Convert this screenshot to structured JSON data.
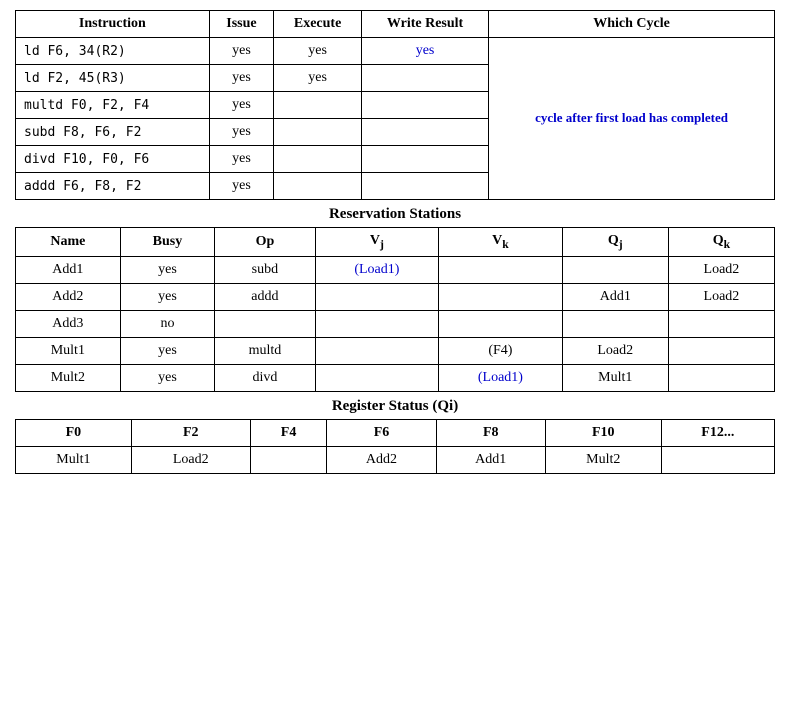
{
  "instruction_table": {
    "headers": [
      "Instruction",
      "Issue",
      "Execute",
      "Write Result",
      "Which Cycle"
    ],
    "rows": [
      {
        "instr": "ld F6, 34(R2)",
        "issue": "yes",
        "execute": "yes",
        "write": "yes",
        "write_blue": true,
        "which_cycle": ""
      },
      {
        "instr": "ld F2, 45(R3)",
        "issue": "yes",
        "execute": "yes",
        "write": "",
        "which_cycle": ""
      },
      {
        "instr": "multd F0, F2, F4",
        "issue": "yes",
        "execute": "",
        "write": "",
        "which_cycle": ""
      },
      {
        "instr": "subd F8, F6, F2",
        "issue": "yes",
        "execute": "",
        "write": "",
        "which_cycle": ""
      },
      {
        "instr": "divd F10, F0, F6",
        "issue": "yes",
        "execute": "",
        "write": "",
        "which_cycle": ""
      },
      {
        "instr": "addd F6, F8, F2",
        "issue": "yes",
        "execute": "",
        "write": "",
        "which_cycle": ""
      }
    ],
    "which_cycle_text": "cycle after first load has completed"
  },
  "reservation_stations": {
    "title": "Reservation Stations",
    "headers": [
      "Name",
      "Busy",
      "Op",
      "Vj",
      "Vk",
      "Qj",
      "Qk"
    ],
    "rows": [
      {
        "name": "Add1",
        "busy": "yes",
        "op": "subd",
        "vj": "(Load1)",
        "vj_blue": true,
        "vk": "",
        "qj": "",
        "qk": "Load2"
      },
      {
        "name": "Add2",
        "busy": "yes",
        "op": "addd",
        "vj": "",
        "vk": "",
        "qj": "Add1",
        "qk": "Load2"
      },
      {
        "name": "Add3",
        "busy": "no",
        "op": "",
        "vj": "",
        "vk": "",
        "qj": "",
        "qk": ""
      },
      {
        "name": "Mult1",
        "busy": "yes",
        "op": "multd",
        "vj": "",
        "vk": "(F4)",
        "qj": "Load2",
        "qk": ""
      },
      {
        "name": "Mult2",
        "busy": "yes",
        "op": "divd",
        "vj": "",
        "vk": "(Load1)",
        "vk_blue": true,
        "qj": "Mult1",
        "qk": ""
      }
    ]
  },
  "register_status": {
    "title": "Register Status (Qi)",
    "headers": [
      "F0",
      "F2",
      "F4",
      "F6",
      "F8",
      "F10",
      "F12..."
    ],
    "row": [
      "Mult1",
      "Load2",
      "",
      "Add2",
      "Add1",
      "Mult2",
      ""
    ]
  }
}
